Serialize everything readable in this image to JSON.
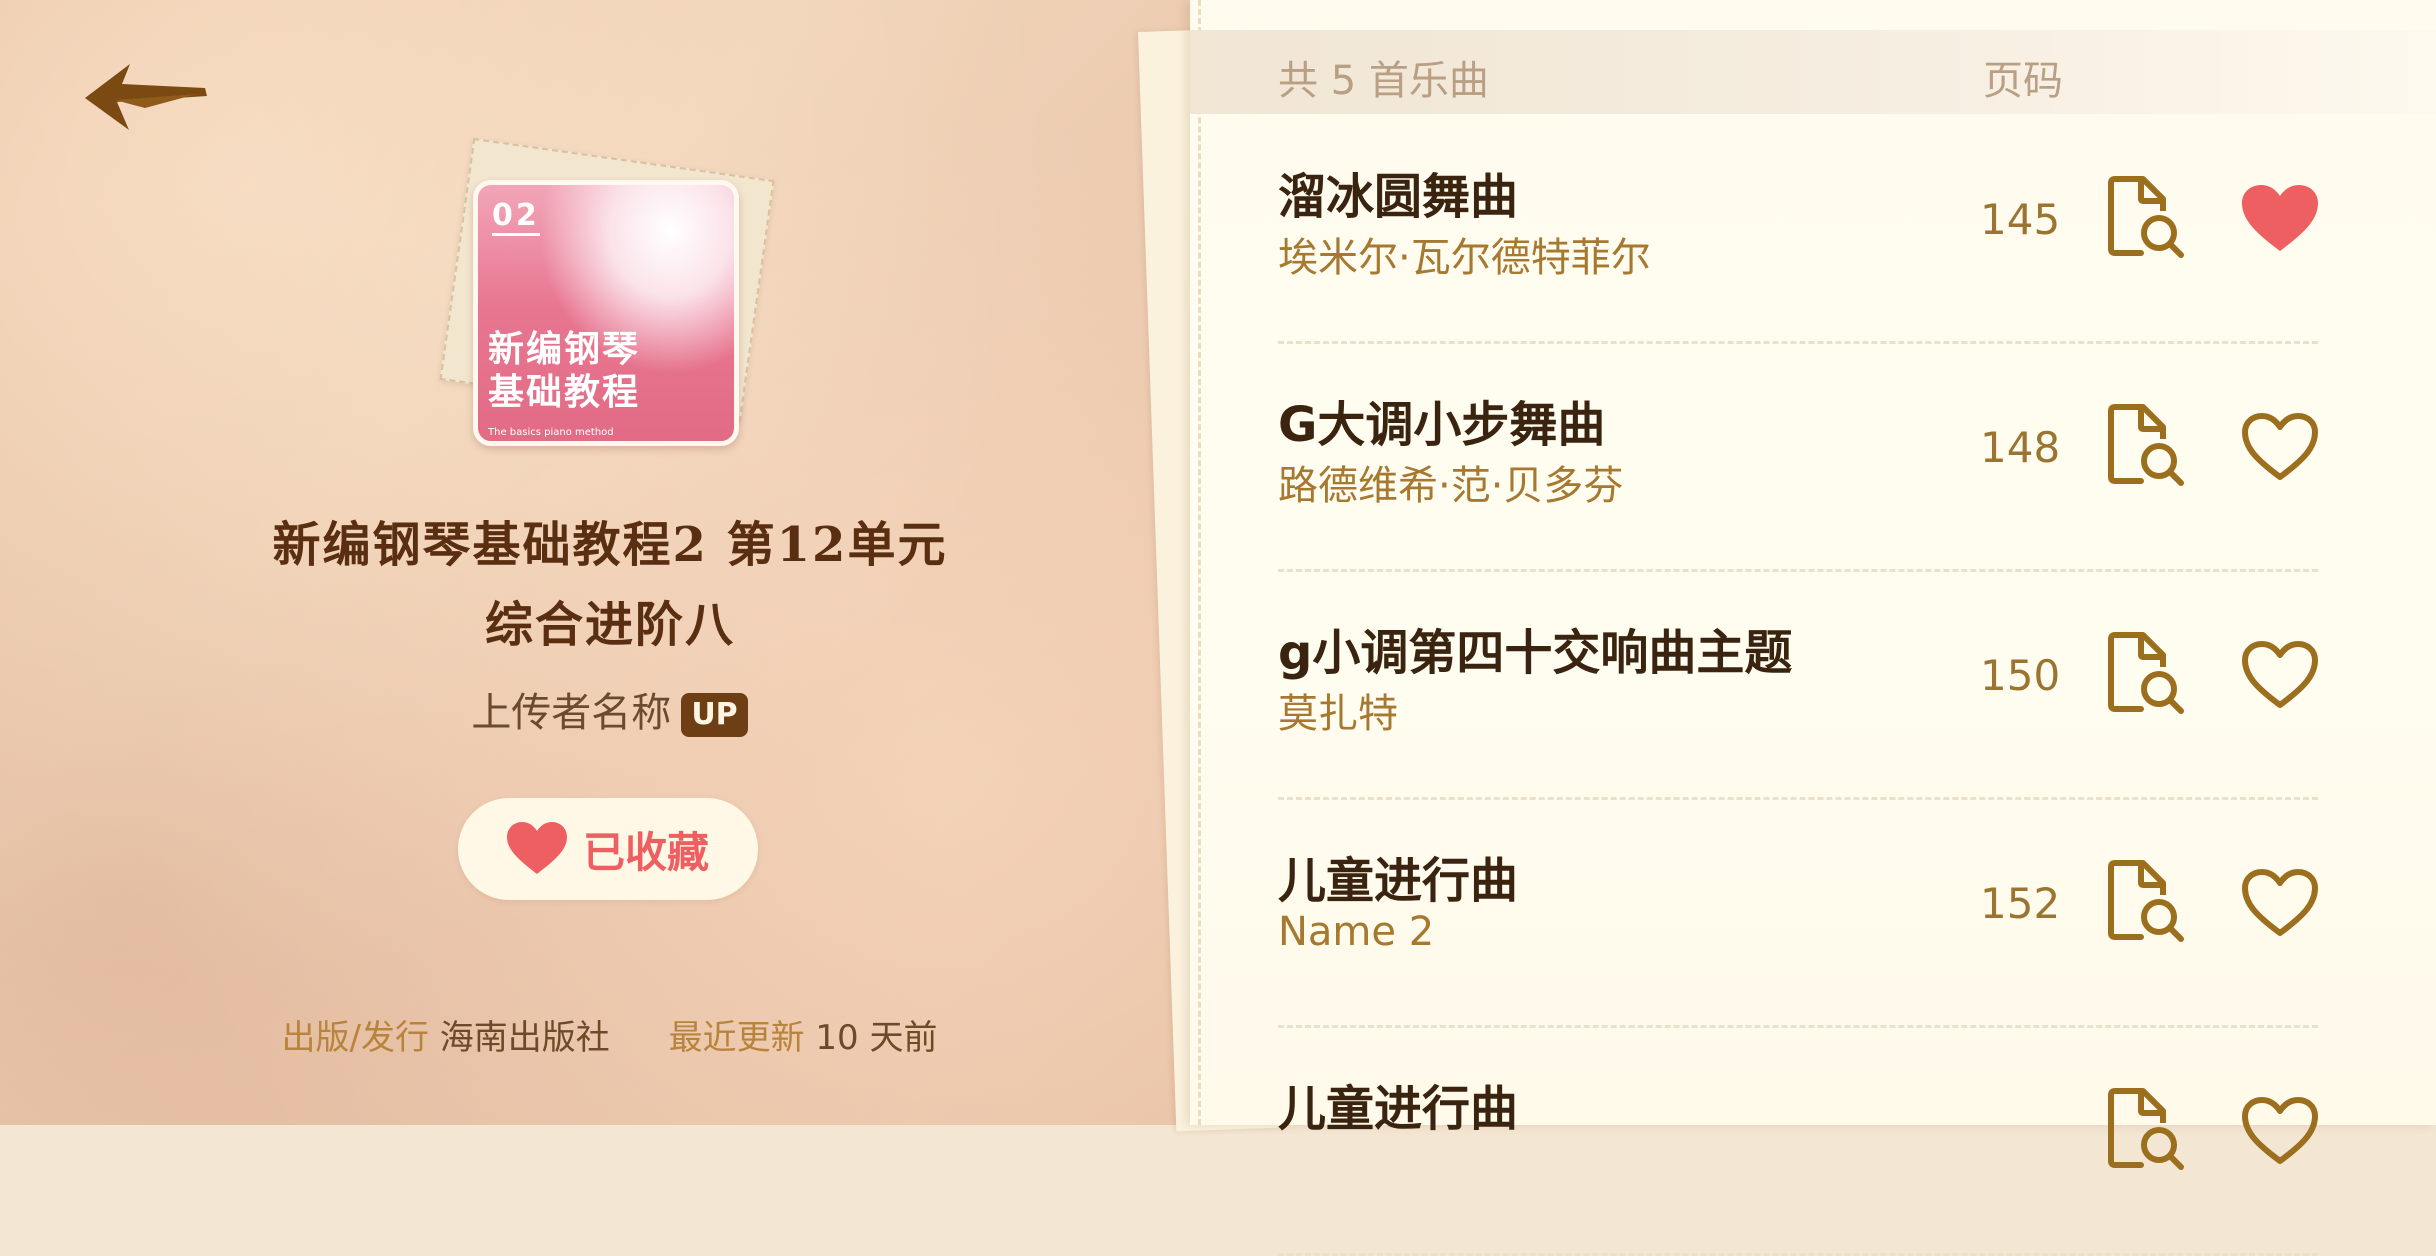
{
  "book": {
    "cover_number": "02",
    "cover_title_line1": "新编钢琴",
    "cover_title_line2": "基础教程",
    "cover_subtitle": "The basics piano method",
    "title_line1": "新编钢琴基础教程2 第12单元",
    "title_line2": "综合进阶八",
    "uploader_name": "上传者名称",
    "uploader_badge": "UP",
    "favorite_label": "已收藏",
    "publisher_key": "出版/发行",
    "publisher_value": "海南出版社",
    "updated_key": "最近更新",
    "updated_value": "10 天前"
  },
  "list": {
    "header_count": "共 5 首乐曲",
    "header_page": "页码",
    "songs": [
      {
        "title": "溜冰圆舞曲",
        "composer": "埃米尔·瓦尔德特菲尔",
        "page": "145",
        "favorited": true
      },
      {
        "title": "G大调小步舞曲",
        "composer": "路德维希·范·贝多芬",
        "page": "148",
        "favorited": false
      },
      {
        "title": "g小调第四十交响曲主题",
        "composer": "莫扎特",
        "page": "150",
        "favorited": false
      },
      {
        "title": "儿童进行曲",
        "composer": "Name 2",
        "page": "152",
        "favorited": false
      },
      {
        "title": "儿童进行曲",
        "composer": "",
        "page": "",
        "favorited": false
      }
    ]
  },
  "icons": {
    "back": "back-arrow-icon",
    "doc_search": "document-search-icon",
    "heart_filled": "heart-filled-icon",
    "heart_outline": "heart-outline-icon"
  },
  "colors": {
    "accent_red": "#ee5f62",
    "gold": "#a7782f",
    "brown_dark": "#3a2410",
    "cover_pink": "#e87690"
  }
}
